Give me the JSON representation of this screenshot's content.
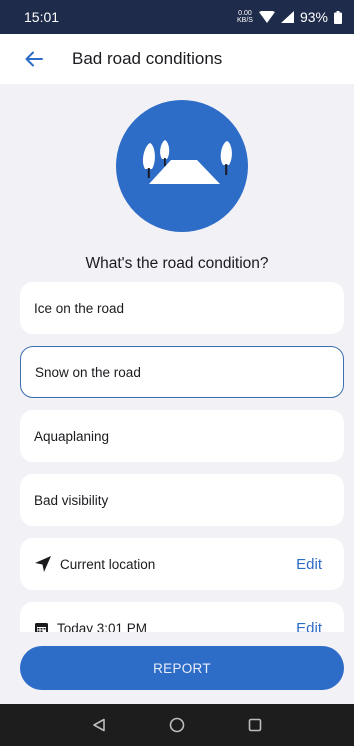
{
  "status_bar": {
    "time": "15:01",
    "net_speed_value": "0.00",
    "net_speed_unit": "KB/S",
    "battery": "93%"
  },
  "app_bar": {
    "title": "Bad road conditions",
    "back_icon": "arrow-left-icon"
  },
  "colors": {
    "accent": "#2d6cc7",
    "status_bar": "#1f2b4a",
    "background": "#f2f1f6"
  },
  "main": {
    "question": "What's the road condition?",
    "options": [
      {
        "label": "Ice on the road",
        "selected": false
      },
      {
        "label": "Snow on the road",
        "selected": true
      },
      {
        "label": "Aquaplaning",
        "selected": false
      },
      {
        "label": "Bad visibility",
        "selected": false
      }
    ],
    "location": {
      "label": "Current location",
      "edit_label": "Edit",
      "icon": "navigation-arrow-icon"
    },
    "datetime": {
      "label": "Today 3:01 PM",
      "edit_label": "Edit",
      "icon": "calendar-icon"
    }
  },
  "report_button": {
    "label": "REPORT"
  },
  "nav_bar": {
    "icons": [
      "back-triangle-icon",
      "home-circle-icon",
      "recents-square-icon"
    ]
  }
}
